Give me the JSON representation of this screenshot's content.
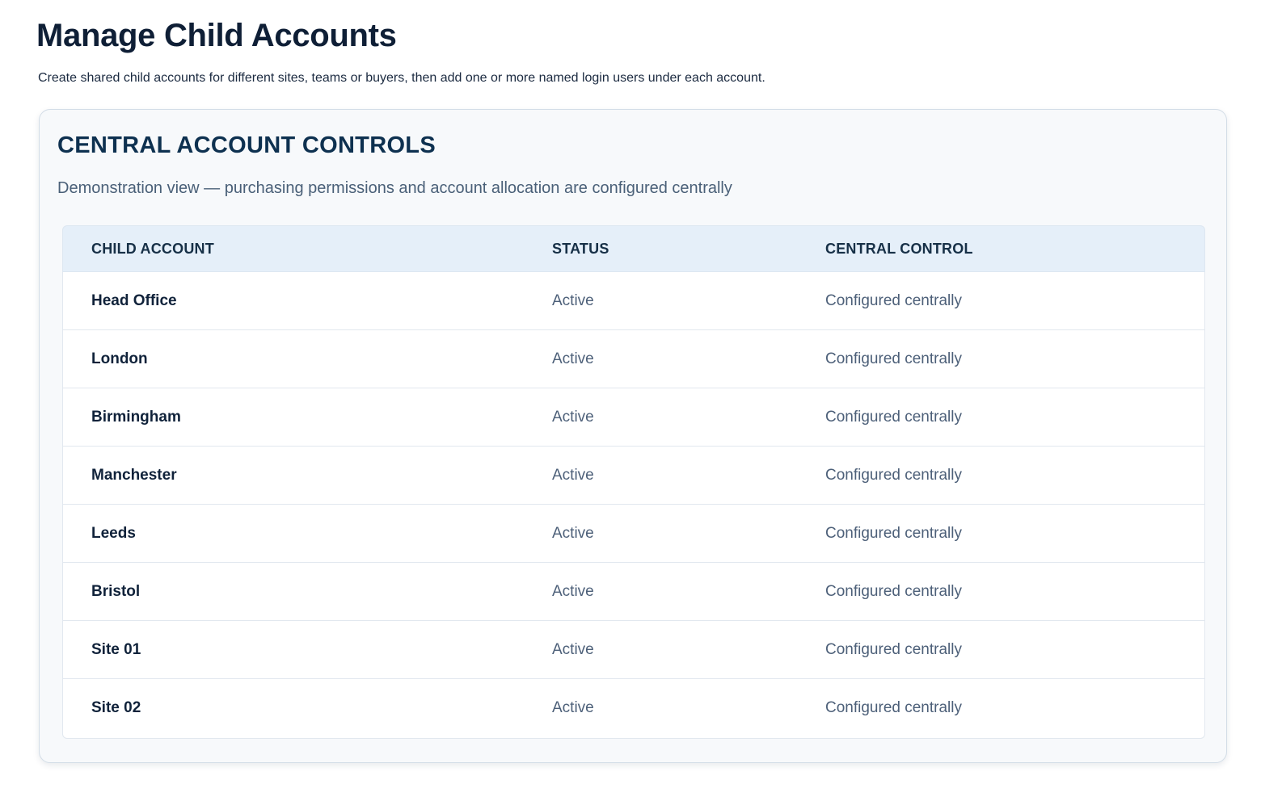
{
  "page": {
    "title": "Manage Child Accounts",
    "subtitle": "Create shared child accounts for different sites, teams or buyers, then add one or more named login users under each account."
  },
  "panel": {
    "title": "CENTRAL ACCOUNT CONTROLS",
    "description": "Demonstration view — purchasing permissions and account allocation are configured centrally"
  },
  "table": {
    "columns": [
      "CHILD ACCOUNT",
      "STATUS",
      "CENTRAL CONTROL"
    ],
    "rows": [
      {
        "account": "Head Office",
        "status": "Active",
        "control": "Configured centrally"
      },
      {
        "account": "London",
        "status": "Active",
        "control": "Configured centrally"
      },
      {
        "account": "Birmingham",
        "status": "Active",
        "control": "Configured centrally"
      },
      {
        "account": "Manchester",
        "status": "Active",
        "control": "Configured centrally"
      },
      {
        "account": "Leeds",
        "status": "Active",
        "control": "Configured centrally"
      },
      {
        "account": "Bristol",
        "status": "Active",
        "control": "Configured centrally"
      },
      {
        "account": "Site 01",
        "status": "Active",
        "control": "Configured centrally"
      },
      {
        "account": "Site 02",
        "status": "Active",
        "control": "Configured centrally"
      }
    ]
  }
}
